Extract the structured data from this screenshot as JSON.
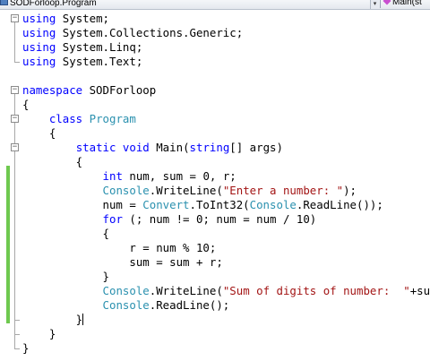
{
  "navbar": {
    "type_combo": "SODForloop.Program",
    "member_combo": "Main(st",
    "dropdown_glyph": "▾"
  },
  "editor": {
    "lines": [
      [
        {
          "t": "using",
          "c": "kw"
        },
        {
          "t": " System;",
          "c": ""
        }
      ],
      [
        {
          "t": "using",
          "c": "kw"
        },
        {
          "t": " System.Collections.Generic;",
          "c": ""
        }
      ],
      [
        {
          "t": "using",
          "c": "kw"
        },
        {
          "t": " System.Linq;",
          "c": ""
        }
      ],
      [
        {
          "t": "using",
          "c": "kw"
        },
        {
          "t": " System.Text;",
          "c": ""
        }
      ],
      [],
      [
        {
          "t": "namespace",
          "c": "kw"
        },
        {
          "t": " SODForloop",
          "c": ""
        }
      ],
      [
        {
          "t": "{",
          "c": ""
        }
      ],
      [
        {
          "t": "    ",
          "c": ""
        },
        {
          "t": "class",
          "c": "kw"
        },
        {
          "t": " ",
          "c": ""
        },
        {
          "t": "Program",
          "c": "ty"
        }
      ],
      [
        {
          "t": "    {",
          "c": ""
        }
      ],
      [
        {
          "t": "        ",
          "c": ""
        },
        {
          "t": "static",
          "c": "kw"
        },
        {
          "t": " ",
          "c": ""
        },
        {
          "t": "void",
          "c": "kw"
        },
        {
          "t": " Main(",
          "c": ""
        },
        {
          "t": "string",
          "c": "kw"
        },
        {
          "t": "[] args)",
          "c": ""
        }
      ],
      [
        {
          "t": "        {",
          "c": ""
        }
      ],
      [
        {
          "t": "            ",
          "c": ""
        },
        {
          "t": "int",
          "c": "kw"
        },
        {
          "t": " num, sum = 0, r;",
          "c": ""
        }
      ],
      [
        {
          "t": "            ",
          "c": ""
        },
        {
          "t": "Console",
          "c": "ty"
        },
        {
          "t": ".WriteLine(",
          "c": ""
        },
        {
          "t": "\"Enter a number: \"",
          "c": "st"
        },
        {
          "t": ");",
          "c": ""
        }
      ],
      [
        {
          "t": "            num = ",
          "c": ""
        },
        {
          "t": "Convert",
          "c": "ty"
        },
        {
          "t": ".ToInt32(",
          "c": ""
        },
        {
          "t": "Console",
          "c": "ty"
        },
        {
          "t": ".ReadLine());",
          "c": ""
        }
      ],
      [
        {
          "t": "            ",
          "c": ""
        },
        {
          "t": "for",
          "c": "kw"
        },
        {
          "t": " (; num != 0; num = num / 10)",
          "c": ""
        }
      ],
      [
        {
          "t": "            {",
          "c": ""
        }
      ],
      [
        {
          "t": "                r = num % 10;",
          "c": ""
        }
      ],
      [
        {
          "t": "                sum = sum + r;",
          "c": ""
        }
      ],
      [
        {
          "t": "            }",
          "c": ""
        }
      ],
      [
        {
          "t": "            ",
          "c": ""
        },
        {
          "t": "Console",
          "c": "ty"
        },
        {
          "t": ".WriteLine(",
          "c": ""
        },
        {
          "t": "\"Sum of digits of number:  \"",
          "c": "st"
        },
        {
          "t": "+sum);",
          "c": ""
        }
      ],
      [
        {
          "t": "            ",
          "c": ""
        },
        {
          "t": "Console",
          "c": "ty"
        },
        {
          "t": ".ReadLine();",
          "c": ""
        }
      ],
      [
        {
          "t": "        }",
          "c": ""
        }
      ],
      [
        {
          "t": "    }",
          "c": ""
        }
      ],
      [
        {
          "t": "}",
          "c": ""
        }
      ]
    ],
    "caret_line": 21,
    "fold_markers": [
      {
        "line": 1,
        "glyph": "−"
      },
      {
        "line": 6,
        "glyph": "−"
      },
      {
        "line": 8,
        "glyph": "−"
      },
      {
        "line": 10,
        "glyph": "−"
      }
    ],
    "changed_lines": [
      11,
      21
    ]
  },
  "colors": {
    "keyword": "#0000ff",
    "type": "#2b91af",
    "string": "#a31515",
    "change_bar": "#6fc94f"
  }
}
